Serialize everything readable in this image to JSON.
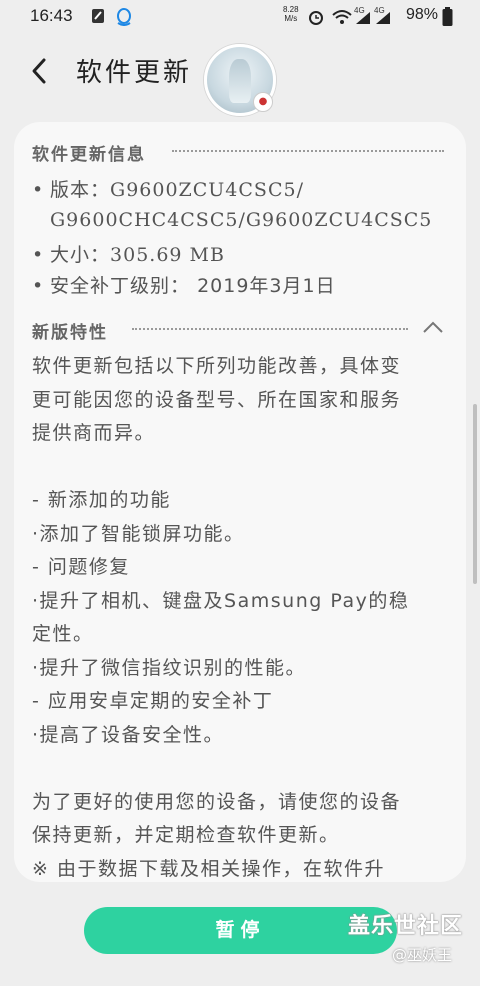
{
  "status_bar": {
    "time": "16:43",
    "net_speed_value": "8.28",
    "net_speed_unit": "M/s",
    "signal_1": "4G",
    "signal_2": "4G",
    "battery": "98%"
  },
  "header": {
    "title": "软件更新"
  },
  "info_section": {
    "heading": "软件更新信息",
    "version_label": "版本：",
    "version_line1": "G9600ZCU4CSC5/",
    "version_line2": "G9600CHC4CSC5/G9600ZCU4CSC5",
    "size_label": "大小：",
    "size_value": "305.69 MB",
    "patch_label": "安全补丁级别：",
    "patch_value": "2019年3月1日"
  },
  "features_section": {
    "heading": "新版特性",
    "lines": [
      "软件更新包括以下所列功能改善，具体变",
      "更可能因您的设备型号、所在国家和服务",
      "提供商而异。",
      "",
      "- 新添加的功能",
      "·添加了智能锁屏功能。",
      "- 问题修复",
      "·提升了相机、键盘及Samsung Pay的稳",
      "定性。",
      "·提升了微信指纹识别的性能。",
      "- 应用安卓定期的安全补丁",
      "·提高了设备安全性。",
      "",
      "为了更好的使用您的设备，请使您的设备",
      "保持更新，并定期检查软件更新。",
      "※ 由于数据下载及相关操作，在软件升"
    ]
  },
  "footer": {
    "pause_label": "暂停"
  },
  "watermark": {
    "site": "盖乐世社区",
    "user": "@巫妖王"
  },
  "colors": {
    "accent": "#2ed2a0",
    "background": "#eeeeee",
    "card": "#f8f8f8"
  }
}
